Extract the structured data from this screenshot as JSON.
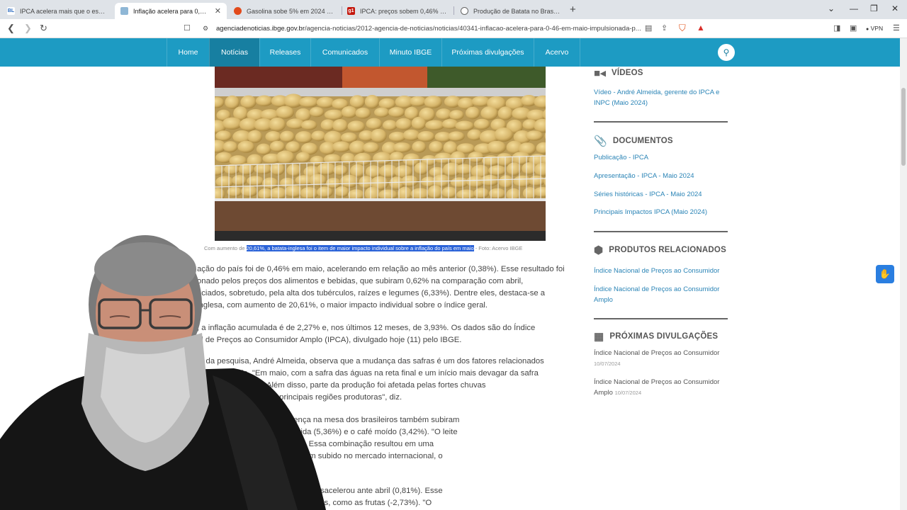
{
  "browser": {
    "tabs": [
      {
        "title": "IPCA acelera mais que o esperado p",
        "favicon": "BL",
        "color": "#2d6cc0"
      },
      {
        "title": "Inflação acelera para 0,46% em",
        "favicon": "",
        "color": "#1d9bc3"
      },
      {
        "title": "Gasolina sobe 5% em 2024 mesmo c",
        "favicon": "",
        "color": "#e24a1b"
      },
      {
        "title": "IPCA: preços sobem 0,46% em maio",
        "favicon": "g1",
        "color": "#c4170c"
      },
      {
        "title": "Produção de Batata no Brasil | IBGE",
        "favicon": "",
        "color": "#777"
      }
    ],
    "url_host": "agenciadenoticias.ibge.gov.br",
    "url_path": "/agencia-noticias/2012-agencia-de-noticias/noticias/40341-inflacao-acelera-para-0-46-em-maio-impulsionada-p...",
    "vpn_label": "VPN",
    "brave_count": "6"
  },
  "nav": {
    "items": [
      "Home",
      "Notícias",
      "Releases",
      "Comunicados",
      "Minuto IBGE",
      "Próximas divulgações",
      "Acervo"
    ],
    "active": "Notícias"
  },
  "caption": {
    "before": "Com aumento de ",
    "highlight": "20,61%, a batata-inglesa foi o item de maior impacto individual sobre a inflação do país em maio",
    "after": " - Foto: Acervo IBGE"
  },
  "article": {
    "p1": [
      "ação do país foi de 0,46% em maio, acelerando em relação ao mês anterior (0,38%). Esse resultado foi",
      "onado pelos preços dos alimentos e bebidas, que subiram 0,62% na comparação com abril,",
      "nciados, sobretudo, pela alta dos tubérculos, raízes e legumes (6,33%). Dentre eles, destaca-se a",
      "inglesa, com aumento de 20,61%, o maior impacto individual sobre o índice geral."
    ],
    "p2": [
      ", a inflação acumulada é de 2,27% e, nos últimos 12 meses, de 3,93%. Os dados são do Índice",
      "al de Preços ao Consumidor Amplo (IPCA), divulgado hoje (11) pelo IBGE."
    ],
    "p3": [
      "te da pesquisa, André Almeida, observa que a mudança das safras é um dos fatores relacionados",
      "o do tubérculo. \"Em maio, com a safra das águas na reta final e um início mais devagar da safra",
      "tata ficou reduzida. Além disso, parte da produção foi afetada pelas fortes chuvas",
      "do Sul, que é uma das principais regiões produtoras\", diz."
    ],
    "p4": [
      "alimentos com grande presença na mesa dos brasileiros também subiram",
      "ebola (7,94%), o leite longa vida (5,36%) e o café moído (3,42%). \"O leite",
      "houve queda nas importações. Essa combinação resultou em uma",
      "os preços das duas espécies têm subido no mercado internacional, o",
      "estaca o pesquisador."
    ],
    "p5": [
      "imentação no domicílio (0,66%) desacelerou ante abril (0,81%). Esse",
      "ações negativas de alguns alimentos, como as frutas (-2,73%). \"O"
    ]
  },
  "sidebar": {
    "videos": {
      "title": "VÍDEOS",
      "links": [
        "Vídeo - André Almeida, gerente do IPCA e INPC (Maio 2024)"
      ]
    },
    "documentos": {
      "title": "DOCUMENTOS",
      "links": [
        "Publicação - IPCA",
        "Apresentação - IPCA - Maio 2024",
        "Séries históricas - IPCA - Maio 2024",
        "Principais Impactos IPCA (Maio 2024)"
      ]
    },
    "produtos": {
      "title": "PRODUTOS RELACIONADOS",
      "links": [
        "Índice Nacional de Preços ao Consumidor",
        "Índice Nacional de Preços ao Consumidor Amplo"
      ]
    },
    "proximas": {
      "title": "PRÓXIMAS DIVULGAÇÕES",
      "items": [
        {
          "name": "Índice Nacional de Preços ao Consumidor",
          "date": "10/07/2024"
        },
        {
          "name": "Índice Nacional de Preços ao Consumidor Amplo",
          "date": "10/07/2024"
        }
      ]
    }
  },
  "colors": {
    "nav": "#1d9bc3",
    "nav_active": "#177fa1",
    "link": "#2a84b6",
    "highlight": "#2b63d8"
  }
}
